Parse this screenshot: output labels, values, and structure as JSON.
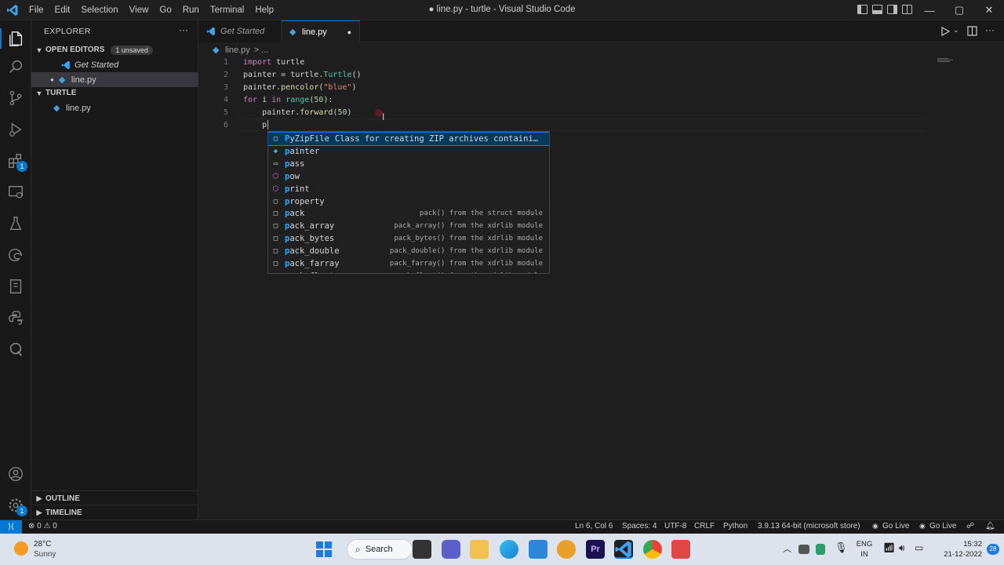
{
  "window": {
    "title": "● line.py - turtle - Visual Studio Code",
    "menu": [
      "File",
      "Edit",
      "Selection",
      "View",
      "Go",
      "Run",
      "Terminal",
      "Help"
    ],
    "controls": {
      "minimize": "—",
      "maximize": "▢",
      "close": "✕"
    }
  },
  "activity": {
    "items": [
      "explorer-icon",
      "search-icon",
      "source-control-icon",
      "run-debug-icon",
      "extensions-icon",
      "remote-explorer-icon",
      "testing-icon",
      "edge-tools-icon",
      "book-icon",
      "python-icon",
      "search-q-icon"
    ],
    "extensions_badge": "1",
    "bottom": [
      "accounts-icon",
      "settings-icon"
    ],
    "settings_badge": "1"
  },
  "sidebar": {
    "header": "EXPLORER",
    "more": "···",
    "open_editors": {
      "title": "OPEN EDITORS",
      "badge": "1 unsaved",
      "items": [
        {
          "label": "Get Started",
          "italic": true
        },
        {
          "label": "line.py",
          "dirty": true
        }
      ]
    },
    "folder": {
      "title": "TURTLE",
      "items": [
        {
          "label": "line.py"
        }
      ]
    },
    "outline": "OUTLINE",
    "timeline": "TIMELINE"
  },
  "tabs": [
    {
      "label": "Get Started",
      "active": false
    },
    {
      "label": "line.py",
      "active": true,
      "dirty": "●"
    }
  ],
  "breadcrumb": {
    "file": "line.py",
    "rest": "> ..."
  },
  "editor": {
    "line_numbers": [
      "1",
      "2",
      "3",
      "4",
      "5",
      "6"
    ],
    "lines": [
      [
        {
          "t": "import",
          "c": "kw"
        },
        {
          "t": " turtle",
          "c": ""
        }
      ],
      [
        {
          "t": "painter = turtle.",
          "c": ""
        },
        {
          "t": "Turtle",
          "c": "bi"
        },
        {
          "t": "()",
          "c": ""
        }
      ],
      [
        {
          "t": "painter.",
          "c": ""
        },
        {
          "t": "pencolor",
          "c": "fn"
        },
        {
          "t": "(",
          "c": ""
        },
        {
          "t": "\"blue\"",
          "c": "str"
        },
        {
          "t": ")",
          "c": ""
        }
      ],
      [
        {
          "t": "for",
          "c": "kw"
        },
        {
          "t": " i ",
          "c": ""
        },
        {
          "t": "in",
          "c": "kw"
        },
        {
          "t": " ",
          "c": ""
        },
        {
          "t": "range",
          "c": "bi"
        },
        {
          "t": "(",
          "c": ""
        },
        {
          "t": "50",
          "c": "num"
        },
        {
          "t": "):",
          "c": ""
        }
      ],
      [
        {
          "t": "    painter.",
          "c": ""
        },
        {
          "t": "forward",
          "c": "fn"
        },
        {
          "t": "(",
          "c": ""
        },
        {
          "t": "50",
          "c": "num"
        },
        {
          "t": ")",
          "c": ""
        }
      ],
      [
        {
          "t": "    p",
          "c": ""
        }
      ]
    ]
  },
  "suggest": {
    "items": [
      {
        "label": "PyZipFile",
        "detail": "Class for creating ZIP archives containi…",
        "icon": "class",
        "focused": true
      },
      {
        "label": "painter",
        "detail": "",
        "icon": "variable"
      },
      {
        "label": "pass",
        "detail": "",
        "icon": "keyword"
      },
      {
        "label": "pow",
        "detail": "",
        "icon": "method"
      },
      {
        "label": "print",
        "detail": "",
        "icon": "method"
      },
      {
        "label": "property",
        "detail": "",
        "icon": "class"
      },
      {
        "label": "pack",
        "detail": "pack() from the struct module",
        "icon": "text"
      },
      {
        "label": "pack_array",
        "detail": "pack_array() from the xdrlib module",
        "icon": "text"
      },
      {
        "label": "pack_bytes",
        "detail": "pack_bytes() from the xdrlib module",
        "icon": "text"
      },
      {
        "label": "pack_double",
        "detail": "pack_double() from the xdrlib module",
        "icon": "text"
      },
      {
        "label": "pack_farray",
        "detail": "pack_farray() from the xdrlib module",
        "icon": "text"
      },
      {
        "label": "pack_float",
        "detail": "pack_float() from the xdrlib module",
        "icon": "text"
      }
    ]
  },
  "status": {
    "remote": "⟩⟨",
    "problems": "⊗ 0 ⚠ 0",
    "position": "Ln 6, Col 6",
    "spaces": "Spaces: 4",
    "encoding": "UTF-8",
    "eol": "CRLF",
    "language": "Python",
    "interpreter": "3.9.13 64-bit (microsoft store)",
    "golive1": "Go Live",
    "golive2": "Go Live"
  },
  "taskbar": {
    "weather_temp": "28°C",
    "weather_desc": "Sunny",
    "search": "Search",
    "lang1": "ENG",
    "lang2": "IN",
    "time": "15:32",
    "date": "21-12-2022",
    "notif": "28"
  },
  "colors": {
    "accent": "#0078d4",
    "editor_bg": "#1e1e1e",
    "taskbar_bg": "#dde3ec"
  }
}
